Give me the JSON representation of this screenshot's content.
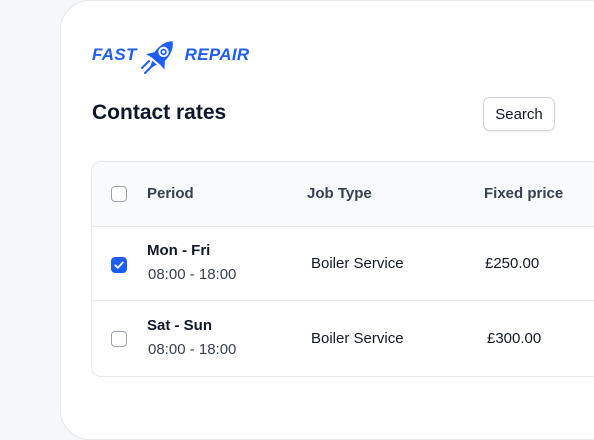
{
  "logo": {
    "left_text": "FAST",
    "right_text": "REPAIR",
    "brand_color": "#1f5ef2"
  },
  "page": {
    "title": "Contact rates",
    "search_label": "Search"
  },
  "table": {
    "headers": [
      "Period",
      "Job Type",
      "Fixed price"
    ],
    "rows": [
      {
        "day": "Mon - Fri",
        "time": "08:00 - 18:00",
        "job_type": "Boiler Service",
        "price": "£250.00",
        "checked": true
      },
      {
        "day": "Sat - Sun",
        "time": "08:00 - 18:00",
        "job_type": "Boiler Service",
        "price": "£300.00",
        "checked": false
      }
    ]
  }
}
